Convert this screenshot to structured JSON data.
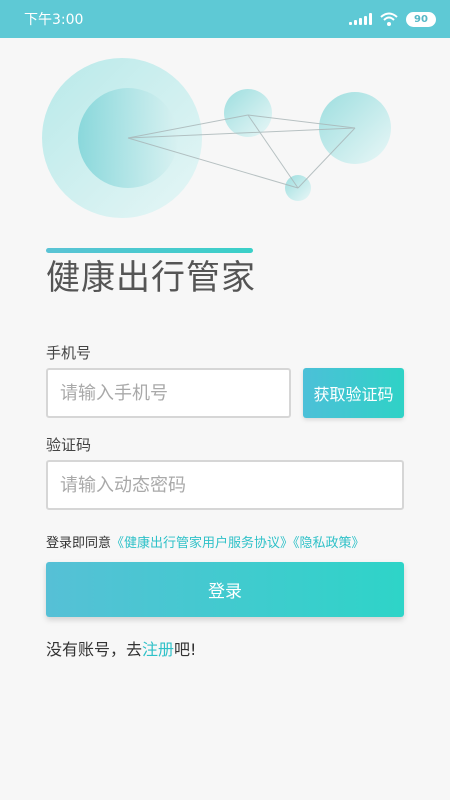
{
  "status_bar": {
    "time": "下午3:00",
    "battery": "90",
    "signal_icon": "signal-icon",
    "wifi_icon": "wifi-icon"
  },
  "app": {
    "title": "健康出行管家"
  },
  "form": {
    "phone_label": "手机号",
    "phone_placeholder": "请输入手机号",
    "get_code_label": "获取验证码",
    "code_label": "验证码",
    "code_placeholder": "请输入动态密码"
  },
  "agreement": {
    "prefix": "登录即同意",
    "user_agreement": "《健康出行管家用户服务协议》",
    "privacy_policy": "《隐私政策》"
  },
  "login_button": "登录",
  "register": {
    "prefix": "没有账号，去",
    "link": "注册",
    "suffix": "吧!"
  },
  "colors": {
    "status_bar": "#5ec9d5",
    "accent": "#2fc1c8",
    "button_gradient_start": "#56c0d6",
    "button_gradient_end": "#2ed4c8"
  }
}
